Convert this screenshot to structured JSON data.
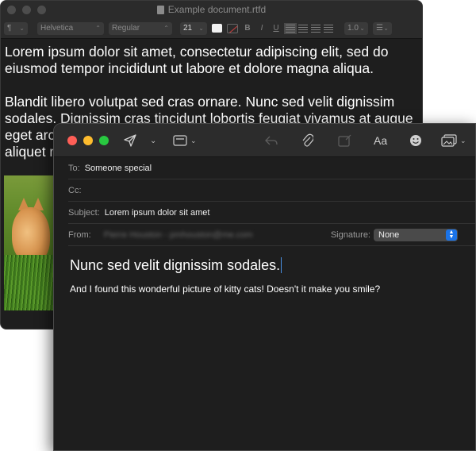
{
  "textedit": {
    "title": "Example document.rtfd",
    "toolbar": {
      "paragraph_style": "¶",
      "font_family": "Helvetica",
      "font_style": "Regular",
      "font_size": "21",
      "bold": "B",
      "italic": "I",
      "underline": "U",
      "line_spacing": "1.0",
      "list": "☰"
    },
    "paragraphs": [
      "Lorem ipsum dolor sit amet, consectetur adipiscing elit, sed do eiusmod tempor incididunt ut labore et dolore magna aliqua.",
      "Blandit libero volutpat sed cras ornare. Nunc sed velit dignissim sodales. Dignissim cras tincidunt lobortis feugiat vivamus at augue eget arcu dictum varius duis at consectetur lorem. Tincidunt id aliquet risus feugiat in ante metus."
    ]
  },
  "mail": {
    "toolbar": {
      "send_icon": "paper-plane-icon",
      "header_fields_icon": "header-fields-icon",
      "reply_icon": "reply-arrow-icon",
      "attach_icon": "paperclip-icon",
      "markup_icon": "markup-icon",
      "format_label": "Aa",
      "emoji_icon": "smiley-icon",
      "photo_icon": "photo-browser-icon"
    },
    "to_label": "To:",
    "to_value": "Someone special",
    "cc_label": "Cc:",
    "cc_value": "",
    "subject_label": "Subject:",
    "subject_value": "Lorem ipsum dolor sit amet",
    "from_label": "From:",
    "from_value": "Pierre Houston - pmhouston@me.com",
    "signature_label": "Signature:",
    "signature_value": "None",
    "body_heading": "Nunc sed velit dignissim sodales.",
    "body_text": "And I found this wonderful picture of kitty cats! Doesn't it make you smile?"
  }
}
